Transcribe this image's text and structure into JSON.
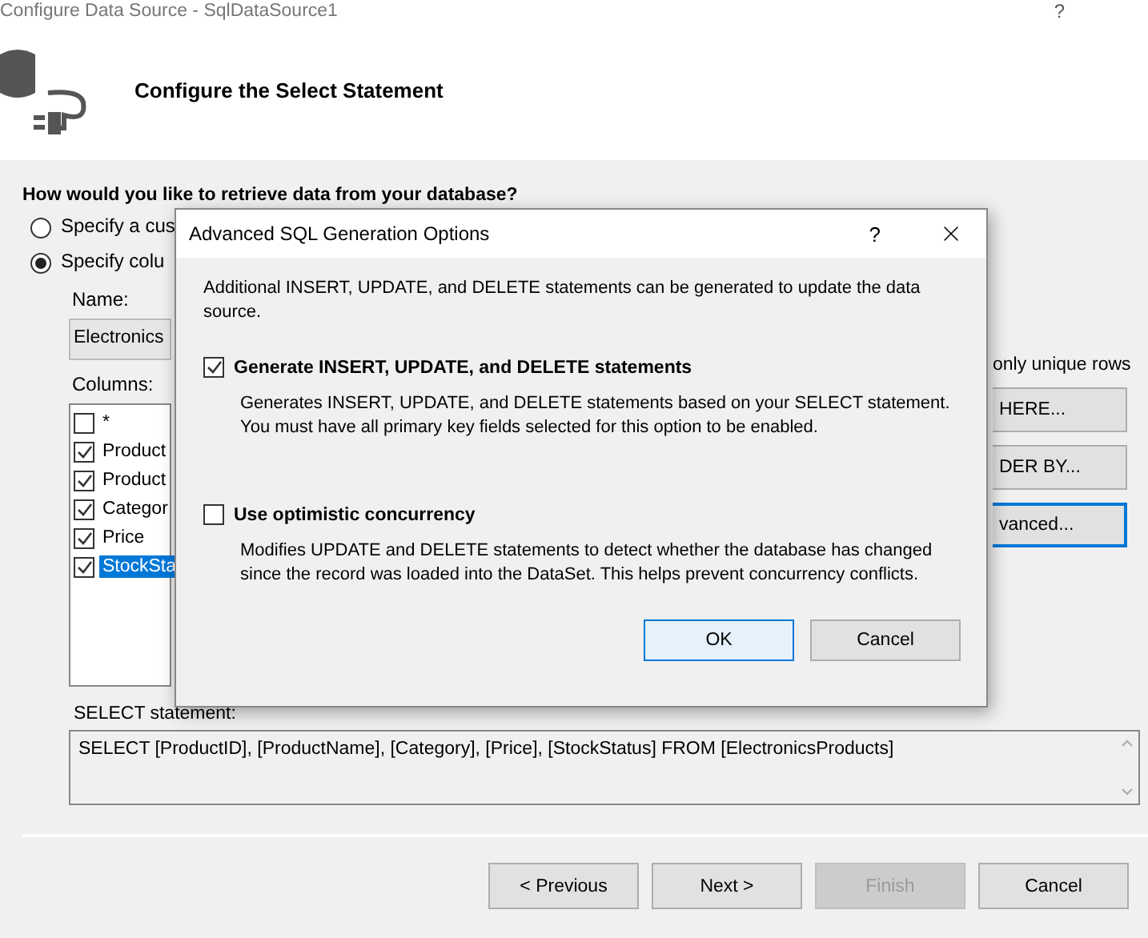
{
  "window": {
    "title": "Configure Data Source - SqlDataSource1",
    "help": "?"
  },
  "header": {
    "title": "Configure the Select Statement"
  },
  "question": "How would you like to retrieve data from your database?",
  "options": [
    {
      "label": "Specify a cus",
      "selected": false
    },
    {
      "label": "Specify colu",
      "selected": true
    }
  ],
  "name_label": "Name:",
  "name_value": "Electronics",
  "columns_label": "Columns:",
  "columns": [
    {
      "label": "*",
      "checked": false,
      "selected": false
    },
    {
      "label": "Product",
      "checked": true,
      "selected": false
    },
    {
      "label": "Product",
      "checked": true,
      "selected": false
    },
    {
      "label": "Categor",
      "checked": true,
      "selected": false
    },
    {
      "label": "Price",
      "checked": true,
      "selected": false
    },
    {
      "label": "StockSta",
      "checked": true,
      "selected": true
    }
  ],
  "right_panel": {
    "unique_rows_label": "only unique rows",
    "buttons": [
      {
        "label": "HERE...",
        "focused": false
      },
      {
        "label": "DER BY...",
        "focused": false
      },
      {
        "label": "vanced...",
        "focused": true
      }
    ]
  },
  "select_label": "SELECT statement:",
  "select_sql": "SELECT [ProductID], [ProductName], [Category], [Price], [StockStatus] FROM [ElectronicsProducts]",
  "nav_buttons": [
    {
      "label": "< Previous",
      "disabled": false
    },
    {
      "label": "Next >",
      "disabled": false
    },
    {
      "label": "Finish",
      "disabled": true
    },
    {
      "label": "Cancel",
      "disabled": false
    }
  ],
  "dialog": {
    "title": "Advanced SQL Generation Options",
    "help": "?",
    "intro": "Additional INSERT, UPDATE, and DELETE statements can be generated to update the data source.",
    "options": [
      {
        "label": "Generate INSERT, UPDATE, and DELETE statements",
        "checked": true,
        "description": "Generates INSERT, UPDATE, and DELETE statements based on your SELECT statement. You must have all primary key fields selected for this option to be enabled."
      },
      {
        "label": "Use optimistic concurrency",
        "checked": false,
        "description": "Modifies UPDATE and DELETE statements to detect whether the database has changed since the record was loaded into the DataSet. This helps prevent concurrency conflicts."
      }
    ],
    "buttons": [
      {
        "label": "OK",
        "default": true
      },
      {
        "label": "Cancel",
        "default": false
      }
    ]
  }
}
